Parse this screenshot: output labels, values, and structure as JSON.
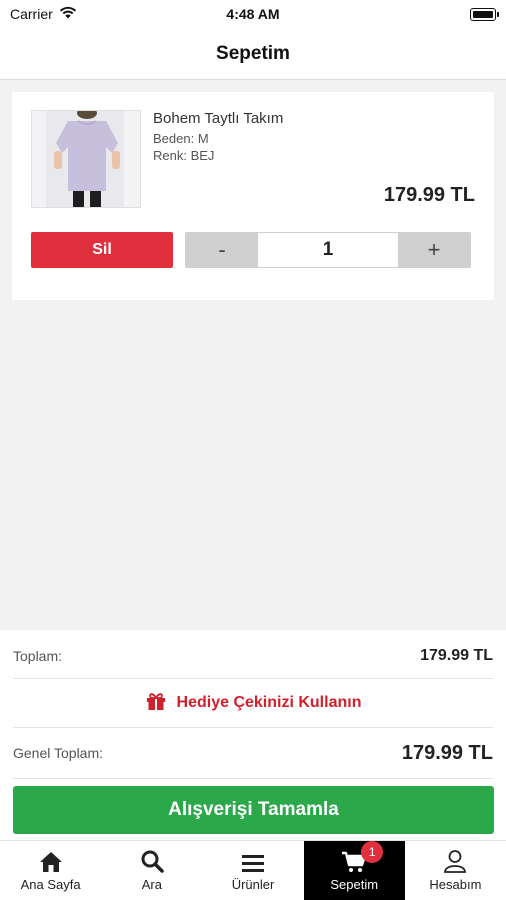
{
  "status_bar": {
    "carrier": "Carrier",
    "time": "4:48 AM"
  },
  "nav": {
    "title": "Sepetim"
  },
  "cart": {
    "items": [
      {
        "name": "Bohem Taytlı Takım",
        "size": "Beden: M",
        "color": "Renk: BEJ",
        "price": "179.99 TL",
        "quantity": "1",
        "delete_label": "Sil",
        "decrement_label": "-",
        "increment_label": "+"
      }
    ]
  },
  "summary": {
    "subtotal_label": "Toplam:",
    "subtotal_value": "179.99 TL",
    "gift_label": "Hediye Çekinizi Kullanın",
    "total_label": "Genel Toplam:",
    "total_value": "179.99 TL",
    "checkout_label": "Alışverişi Tamamla"
  },
  "tabs": [
    {
      "label": "Ana Sayfa",
      "icon": "home-icon"
    },
    {
      "label": "Ara",
      "icon": "search-icon"
    },
    {
      "label": "Ürünler",
      "icon": "menu-icon"
    },
    {
      "label": "Sepetim",
      "icon": "cart-icon",
      "badge": "1",
      "active": true
    },
    {
      "label": "Hesabım",
      "icon": "user-icon"
    }
  ],
  "colors": {
    "accent_red": "#e0303e",
    "checkout_green": "#2aa84a",
    "active_tab": "#000000"
  }
}
